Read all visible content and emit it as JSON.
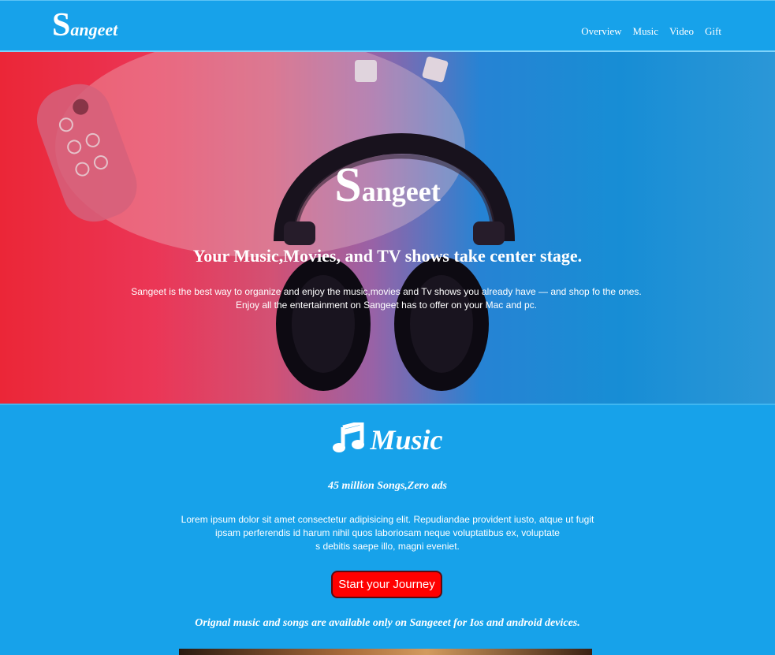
{
  "navbar": {
    "brand_cap": "S",
    "brand_rest": "angeet",
    "links": [
      "Overview",
      "Music",
      "Video",
      "Gift"
    ]
  },
  "hero": {
    "title_cap": "S",
    "title_rest": "angeet",
    "subtitle": "Your Music,Movies, and TV shows take center stage.",
    "desc_line1": "Sangeet is the best way to organize and enjoy the music,movies and Tv shows you already have — and shop fo the ones.",
    "desc_line2": "Enjoy all the entertainment on Sangeet has to offer on your Mac and pc."
  },
  "music": {
    "icon": "music-note-icon",
    "heading": "Music",
    "tagline": "45 million Songs,Zero ads",
    "lorem_line1": "Lorem ipsum dolor sit amet consectetur adipisicing elit. Repudiandae provident iusto, atque ut fugit",
    "lorem_line2": "ipsam perferendis id harum nihil quos laboriosam neque voluptatibus ex, voluptate",
    "lorem_line3": "s debitis saepe illo, magni eveniet.",
    "cta_label": "Start your Journey",
    "note": "Orignal music and songs are available only on Sangeeet for Ios and android devices."
  },
  "colors": {
    "brand_blue": "#17a2ea",
    "cta_red": "#ff0000"
  }
}
